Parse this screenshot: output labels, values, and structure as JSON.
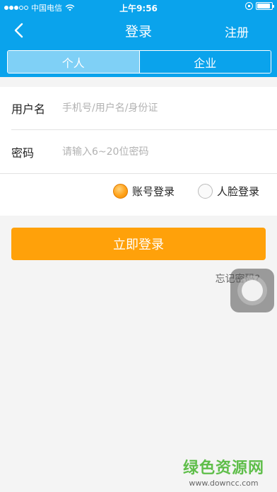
{
  "status_bar": {
    "carrier": "中国电信",
    "time": "上午9:56",
    "signal_dots_filled": 3,
    "signal_dots_total": 5,
    "battery_level": 0.9
  },
  "nav": {
    "title": "登录",
    "register_label": "注册",
    "back_icon": "chevron-left-icon"
  },
  "tabs": [
    {
      "label": "个人",
      "active": true
    },
    {
      "label": "企业",
      "active": false
    }
  ],
  "form": {
    "username": {
      "label": "用户名",
      "placeholder": "手机号/用户名/身份证",
      "value": ""
    },
    "password": {
      "label": "密码",
      "placeholder": "请输入6~20位密码",
      "value": ""
    }
  },
  "login_type": {
    "options": [
      {
        "label": "账号登录",
        "checked": true
      },
      {
        "label": "人脸登录",
        "checked": false
      }
    ]
  },
  "login_button_label": "立即登录",
  "forgot_password_label": "忘记密码?",
  "watermark": {
    "title": "绿色资源网",
    "url": "www.downcc.com"
  },
  "colors": {
    "header_blue": "#0aa3ec",
    "active_tab": "#7fd0f6",
    "login_orange": "#ffa10a",
    "watermark_green": "#5fbe4a"
  }
}
